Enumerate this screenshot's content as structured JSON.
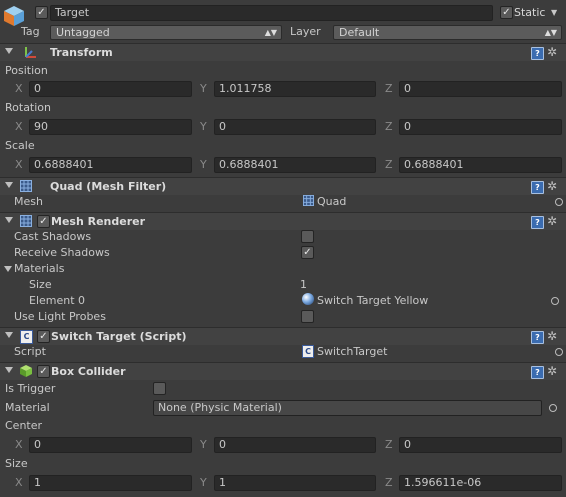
{
  "object": {
    "name": "Target",
    "static_label": "Static",
    "tag_label": "Tag",
    "tag_value": "Untagged",
    "layer_label": "Layer",
    "layer_value": "Default"
  },
  "transform": {
    "title": "Transform",
    "position_label": "Position",
    "rotation_label": "Rotation",
    "scale_label": "Scale",
    "x_label": "X",
    "y_label": "Y",
    "z_label": "Z",
    "position": {
      "x": "0",
      "y": "1.011758",
      "z": "0"
    },
    "rotation": {
      "x": "90",
      "y": "0",
      "z": "0"
    },
    "scale": {
      "x": "0.6888401",
      "y": "0.6888401",
      "z": "0.6888401"
    }
  },
  "mesh_filter": {
    "title": "Quad (Mesh Filter)",
    "mesh_label": "Mesh",
    "mesh_value": "Quad"
  },
  "mesh_renderer": {
    "title": "Mesh Renderer",
    "cast_shadows_label": "Cast Shadows",
    "receive_shadows_label": "Receive Shadows",
    "materials_label": "Materials",
    "size_label": "Size",
    "size_value": "1",
    "element0_label": "Element 0",
    "element0_value": "Switch Target Yellow",
    "light_probes_label": "Use Light Probes"
  },
  "switch_target": {
    "title": "Switch Target (Script)",
    "script_label": "Script",
    "script_value": "SwitchTarget"
  },
  "box_collider": {
    "title": "Box Collider",
    "is_trigger_label": "Is Trigger",
    "material_label": "Material",
    "material_value": "None (Physic Material)",
    "center_label": "Center",
    "size_label": "Size",
    "center": {
      "x": "0",
      "y": "0",
      "z": "0"
    },
    "size": {
      "x": "1",
      "y": "1",
      "z": "1.596611e-06"
    }
  },
  "icons": {
    "help": "help-icon",
    "gear": "gear-icon",
    "object": "cube-icon"
  },
  "colors": {
    "background": "#3c3c3c",
    "field": "#2a2a2a",
    "header": "#424242"
  }
}
